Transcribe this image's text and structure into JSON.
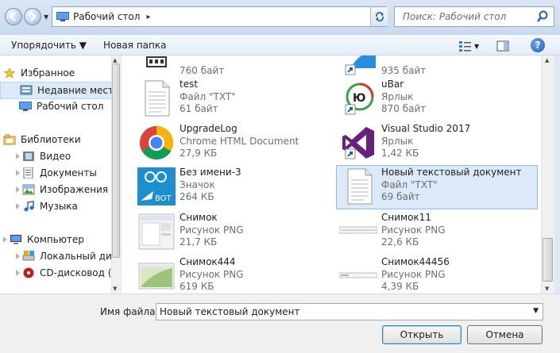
{
  "address": {
    "location": "Рабочий стол",
    "separator": "▸",
    "search_placeholder": "Поиск: Рабочий стол"
  },
  "toolbar": {
    "organize": "Упорядочить ▼",
    "new_folder": "Новая папка",
    "help": "?"
  },
  "nav": {
    "favorites": "Избранное",
    "recent": "Недавние места",
    "desktop": "Рабочий стол",
    "libraries": "Библиотеки",
    "video": "Видео",
    "documents": "Документы",
    "images": "Изображения",
    "music": "Музыка",
    "computer": "Компьютер",
    "local_disk": "Локальный диск",
    "cd_drive": "CD-дисковод (D:"
  },
  "files": [
    {
      "name": "",
      "type": "",
      "size": "760 байт",
      "icon": "generic-app-icon"
    },
    {
      "name": "",
      "type": "",
      "size": "935 байт",
      "icon": "blue-shortcut-icon"
    },
    {
      "name": "test",
      "type": "Файл \"TXT\"",
      "size": "61 байт",
      "icon": "text-file-icon"
    },
    {
      "name": "uBar",
      "type": "Ярлык",
      "size": "870 байт",
      "icon": "ubar-icon"
    },
    {
      "name": "UpgradeLog",
      "type": "Chrome HTML Document",
      "size": "27,9 КБ",
      "icon": "chrome-icon"
    },
    {
      "name": "Visual Studio 2017",
      "type": "Ярлык",
      "size": "1,42 КБ",
      "icon": "visual-studio-icon"
    },
    {
      "name": "Без имени-3",
      "type": "Значок",
      "size": "264 КБ",
      "icon": "arduino-bot-icon"
    },
    {
      "name": "Новый текстовый документ",
      "type": "Файл \"TXT\"",
      "size": "69 байт",
      "icon": "text-file-icon"
    },
    {
      "name": "Снимок",
      "type": "Рисунок PNG",
      "size": "21,7 КБ",
      "icon": "screenshot-thumb-icon"
    },
    {
      "name": "Снимок11",
      "type": "Рисунок PNG",
      "size": "22,6 КБ",
      "icon": "screenshot-thumb-icon"
    },
    {
      "name": "Снимок444",
      "type": "Рисунок PNG",
      "size": "619 КБ",
      "icon": "photo-thumb-icon"
    },
    {
      "name": "Снимок44456",
      "type": "Рисунок PNG",
      "size": "4,39 КБ",
      "icon": "screenshot-thumb-icon"
    }
  ],
  "bottom": {
    "filename_label": "Имя файла:",
    "filename_value": "Новый текстовый документ",
    "open": "Открыть",
    "cancel": "Отмена"
  }
}
